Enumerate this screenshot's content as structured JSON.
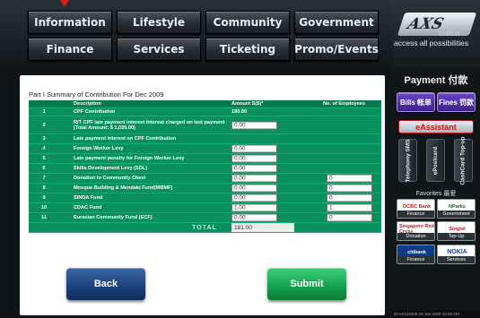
{
  "topnav": {
    "row1": [
      "Information",
      "Lifestyle",
      "Community",
      "Government"
    ],
    "row2": [
      "Finance",
      "Services",
      "Ticketing",
      "Promo/Events"
    ]
  },
  "brand": {
    "logo": "AXS",
    "station": "station",
    "tagline": "access all possibilities"
  },
  "form": {
    "title": "Part I Summary of Contribution For Dec 2009",
    "headers": {
      "description": "Description",
      "amount": "Amount S($)*",
      "employees": "No. of Employees"
    },
    "rows": [
      {
        "no": "1",
        "description": "CPF Contribution",
        "amount": "180.00",
        "employees": ""
      },
      {
        "no": "2",
        "description": "R/T CPF late payment interest Interest charged on last payment (Total Amount: $ 1,020.00)",
        "amount": "0.00",
        "employees": ""
      },
      {
        "no": "3",
        "description": "Late payment interest on CPF Contribution",
        "amount": "",
        "employees": ""
      },
      {
        "no": "4",
        "description": "Foreign Worker Levy",
        "amount": "0.00",
        "employees": ""
      },
      {
        "no": "5",
        "description": "Late payment penalty for Foreign Worker Levy",
        "amount": "0.00",
        "employees": ""
      },
      {
        "no": "6",
        "description": "Skills Development Levy (SDL)",
        "amount": "0.00",
        "employees": ""
      },
      {
        "no": "7",
        "description": "Donation to Community Chest",
        "amount": "0.00",
        "employees": "0"
      },
      {
        "no": "8",
        "description": "Mosque Building & Mendaki Fund(MBMF)",
        "amount": "0.00",
        "employees": "0"
      },
      {
        "no": "9",
        "description": "SINDA Fund",
        "amount": "0.00",
        "employees": "0"
      },
      {
        "no": "10",
        "description": "CDAC Fund",
        "amount": "1.00",
        "employees": "1"
      },
      {
        "no": "11",
        "description": "Eurasian Community Fund (ECF)",
        "amount": "0.00",
        "employees": "0"
      }
    ],
    "total_label": "TOTAL",
    "total_value": "181.00",
    "back_label": "Back",
    "submit_label": "Submit"
  },
  "sidebar": {
    "payment_title": "Payment 付款",
    "bills": "Bills 帐单",
    "fines": "Fines 罚款",
    "eassistant": "eAssistant",
    "vertical": [
      "Telephony SMS",
      "ePostcard",
      "CashCard Top-up"
    ],
    "favorites_label": "Favorites 最爱",
    "favorites": [
      {
        "name": "OCBC Bank",
        "caption": "Finance"
      },
      {
        "name": "NParks",
        "caption": "Government"
      },
      {
        "name": "Singapore Red Cross",
        "caption": "Donation"
      },
      {
        "name": "Singtel",
        "caption": "Top-Up"
      },
      {
        "name": "citibank",
        "caption": "Finance"
      },
      {
        "name": "NOKIA",
        "caption": "Services"
      }
    ],
    "footer": "ID:AK112006  26 Jan 2009  10:58 AM"
  },
  "colors": {
    "table_green": "#0a8f5e",
    "submit_green": "#14a04e",
    "back_blue": "#1b3f78",
    "bills_purple": "#3b1f8a"
  }
}
